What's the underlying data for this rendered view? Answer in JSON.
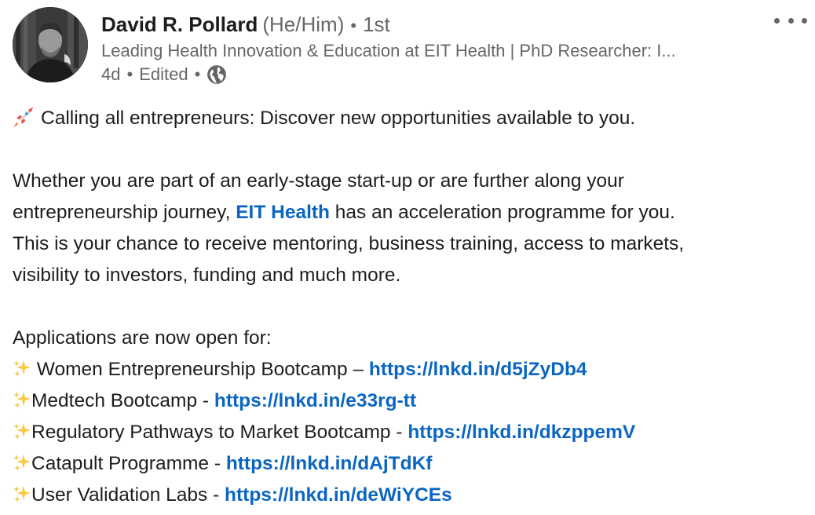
{
  "author": {
    "name": "David R. Pollard",
    "pronouns": "(He/Him)",
    "separator": "•",
    "degree": "1st",
    "headline": "Leading Health Innovation & Education at EIT Health | PhD Researcher: I...",
    "age": "4d",
    "edited": "Edited",
    "visibility_icon": "globe-icon"
  },
  "menu": {
    "icon": "more-options-icon"
  },
  "post": {
    "intro_icon": "rocket-icon",
    "intro": "Calling all entrepreneurs: Discover new opportunities available to you.",
    "para_before": "Whether you are part of an early-stage start-up or are further along your",
    "para_line2_before": "entrepreneurship journey, ",
    "para_link": "EIT Health",
    "para_line2_after": " has an acceleration programme for you.",
    "para_line3": "This is your chance to receive mentoring, business training, access to markets,",
    "para_line4": "visibility to investors, funding and much more.",
    "applications_heading": "Applications are now open for:",
    "item_icon": "sparkles-icon",
    "items": [
      {
        "label": " Women Entrepreneurship Bootcamp – ",
        "url": "https://lnkd.in/d5jZyDb4"
      },
      {
        "label": "Medtech Bootcamp - ",
        "url": "https://lnkd.in/e33rg-tt"
      },
      {
        "label": "Regulatory Pathways to Market Bootcamp - ",
        "url": "https://lnkd.in/dkzppemV"
      },
      {
        "label": "Catapult Programme - ",
        "url": "https://lnkd.in/dAjTdKf"
      },
      {
        "label": "User Validation Labs - ",
        "url": "https://lnkd.in/deWiYCEs"
      }
    ]
  },
  "colors": {
    "link": "#0a66c2",
    "muted": "#666666",
    "text": "#1d1d1d"
  }
}
